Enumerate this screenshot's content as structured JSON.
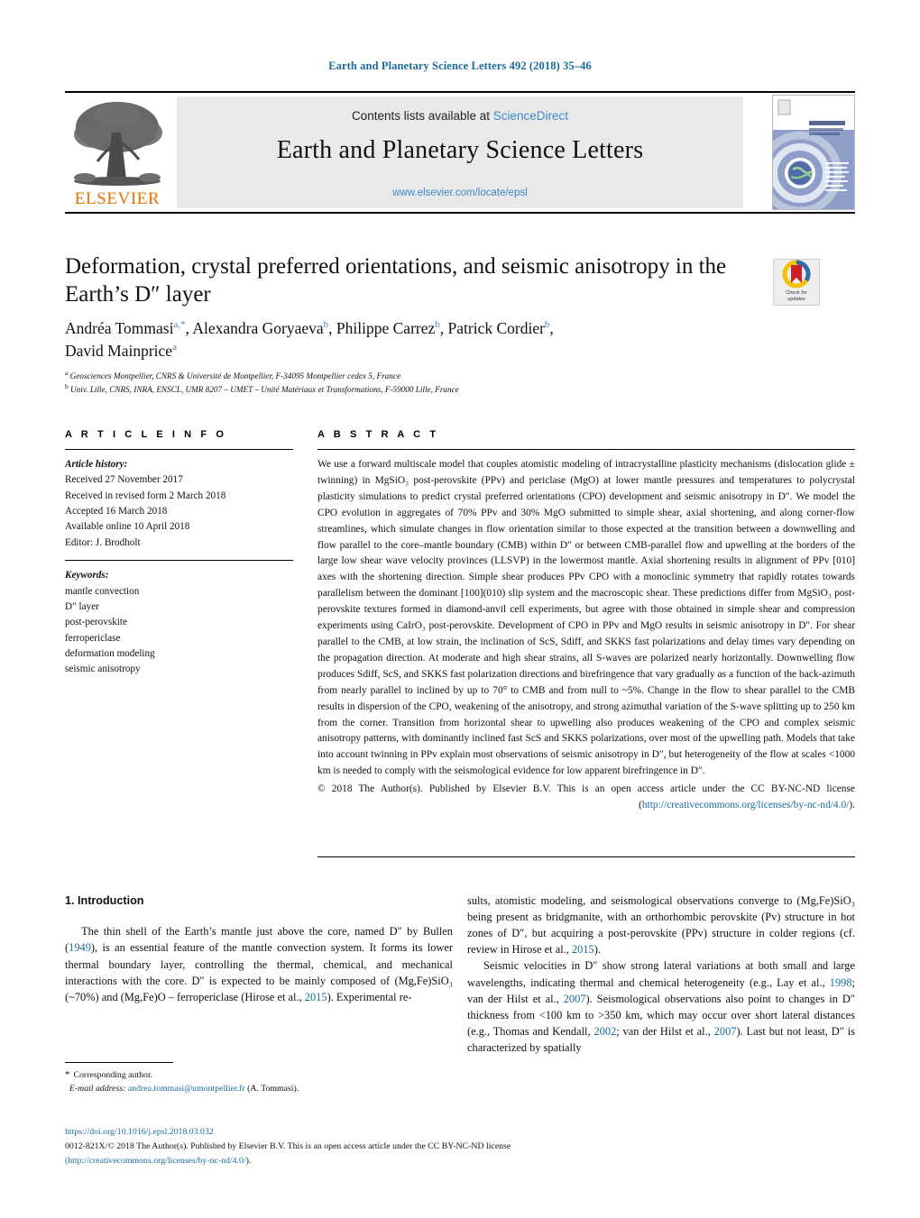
{
  "running_head": "Earth and Planetary Science Letters 492 (2018) 35–46",
  "masthead": {
    "contents_prefix": "Contents lists available at ",
    "sciencedirect": "ScienceDirect",
    "journal_title": "Earth and Planetary Science Letters",
    "journal_url": "www.elsevier.com/locate/epsl",
    "publisher_wordmark": "ELSEVIER",
    "cover_title_line1": "EARTH",
    "cover_title_line2": "AND PLANETARY",
    "cover_title_line3": "SCIENCE LETTERS"
  },
  "article": {
    "title": "Deformation, crystal preferred orientations, and seismic anisotropy in the Earth’s D″ layer",
    "crossmark_label_line1": "Check for",
    "crossmark_label_line2": "updates",
    "affiliation_a": "Geosciences Montpellier, CNRS & Université de Montpellier, F-34095 Montpellier cedex 5, France",
    "affiliation_b": "Univ. Lille, CNRS, INRA, ENSCL, UMR 8207 – UMET – Unité Matériaux et Transformations, F-59000 Lille, France"
  },
  "authors": [
    {
      "name": "Andréa Tommasi",
      "marks": "a,*",
      "sep": ", "
    },
    {
      "name": "Alexandra Goryaeva",
      "marks": "b",
      "sep": ", "
    },
    {
      "name": "Philippe Carrez",
      "marks": "b",
      "sep": ", "
    },
    {
      "name": "Patrick Cordier",
      "marks": "b",
      "sep": ","
    },
    {
      "name": "David Mainprice",
      "marks": "a",
      "sep": ""
    }
  ],
  "article_info": {
    "heading": "A R T I C L E    I N F O",
    "history_label": "Article history:",
    "history": [
      "Received 27 November 2017",
      "Received in revised form 2 March 2018",
      "Accepted 16 March 2018",
      "Available online 10 April 2018",
      "Editor: J. Brodholt"
    ],
    "keywords_label": "Keywords:",
    "keywords": [
      "mantle convection",
      "D″ layer",
      "post-perovskite",
      "ferropericlase",
      "deformation modeling",
      "seismic anisotropy"
    ]
  },
  "abstract": {
    "heading": "A B S T R A C T",
    "text": "We use a forward multiscale model that couples atomistic modeling of intracrystalline plasticity mechanisms (dislocation glide ± twinning) in MgSiO₃ post-perovskite (PPv) and periclase (MgO) at lower mantle pressures and temperatures to polycrystal plasticity simulations to predict crystal preferred orientations (CPO) development and seismic anisotropy in D″. We model the CPO evolution in aggregates of 70% PPv and 30% MgO submitted to simple shear, axial shortening, and along corner-flow streamlines, which simulate changes in flow orientation similar to those expected at the transition between a downwelling and flow parallel to the core–mantle boundary (CMB) within D″ or between CMB-parallel flow and upwelling at the borders of the large low shear wave velocity provinces (LLSVP) in the lowermost mantle. Axial shortening results in alignment of PPv [010] axes with the shortening direction. Simple shear produces PPv CPO with a monoclinic symmetry that rapidly rotates towards parallelism between the dominant [100](010) slip system and the macroscopic shear. These predictions differ from MgSiO₃ post-perovskite textures formed in diamond-anvil cell experiments, but agree with those obtained in simple shear and compression experiments using CaIrO₃ post-perovskite. Development of CPO in PPv and MgO results in seismic anisotropy in D″. For shear parallel to the CMB, at low strain, the inclination of ScS, Sdiff, and SKKS fast polarizations and delay times vary depending on the propagation direction. At moderate and high shear strains, all S-waves are polarized nearly horizontally. Downwelling flow produces Sdiff, ScS, and SKKS fast polarization directions and birefringence that vary gradually as a function of the back-azimuth from nearly parallel to inclined by up to 70° to CMB and from null to ~5%. Change in the flow to shear parallel to the CMB results in dispersion of the CPO, weakening of the anisotropy, and strong azimuthal variation of the S-wave splitting up to 250 km from the corner. Transition from horizontal shear to upwelling also produces weakening of the CPO and complex seismic anisotropy patterns, with dominantly inclined fast ScS and SKKS polarizations, over most of the upwelling path. Models that take into account twinning in PPv explain most observations of seismic anisotropy in D″, but heterogeneity of the flow at scales <1000 km is needed to comply with the seismological evidence for low apparent birefringence in D″.",
    "copyright_text": "© 2018 The Author(s). Published by Elsevier B.V. This is an open access article under the CC BY-NC-ND license (",
    "copyright_link": "http://creativecommons.org/licenses/by-nc-nd/4.0/",
    "copyright_tail": ")."
  },
  "body": {
    "section_heading": "1. Introduction",
    "left_p1_a": "The thin shell of the Earth’s mantle just above the core, named D″ by Bullen (",
    "left_p1_cite1": "1949",
    "left_p1_b": "), is an essential feature of the mantle convection system. It forms its lower thermal boundary layer, controlling the thermal, chemical, and mechanical interactions with the core. D″ is expected to be mainly composed of (Mg,Fe)SiO₃ (~70%) and (Mg,Fe)O – ferropericlase (Hirose et al., ",
    "left_p1_cite2": "2015",
    "left_p1_c": "). Experimental re-",
    "right_p1_a": "sults, atomistic modeling, and seismological observations converge to (Mg,Fe)SiO₃ being present as bridgmanite, with an orthorhombic perovskite (Pv) structure in hot zones of D″, but acquiring a post-perovskite (PPv) structure in colder regions (cf. review in Hirose et al., ",
    "right_p1_cite": "2015",
    "right_p1_b": ").",
    "right_p2_a": "Seismic velocities in D″ show strong lateral variations at both small and large wavelengths, indicating thermal and chemical heterogeneity (e.g., Lay et al., ",
    "right_p2_cite1": "1998",
    "right_p2_b": "; van der Hilst et al., ",
    "right_p2_cite2": "2007",
    "right_p2_c": "). Seismological observations also point to changes in D″ thickness from <100 km to >350 km, which may occur over short lateral distances (e.g., Thomas and Kendall, ",
    "right_p2_cite3": "2002",
    "right_p2_d": "; van der Hilst et al., ",
    "right_p2_cite4": "2007",
    "right_p2_e": "). Last but not least, D″ is characterized by spatially"
  },
  "footnotes": {
    "corresponding_mark": "*",
    "corresponding_text": "Corresponding author.",
    "email_label": "E-mail address:",
    "email": "andrea.tommasi@umontpellier.fr",
    "email_suffix": "(A. Tommasi).",
    "doi": "https://doi.org/10.1016/j.epsl.2018.03.032",
    "issn_line_a": "0012-821X/© 2018 The Author(s). Published by Elsevier B.V. This is an open access article under the CC BY-NC-ND license",
    "issn_link": "(http://creativecommons.org/licenses/by-nc-nd/4.0/",
    "issn_tail": ")."
  },
  "colors": {
    "link_blue": "#1a6b9a",
    "sciencedirect_blue": "#3f88c5",
    "elsevier_orange": "#eb7100"
  }
}
